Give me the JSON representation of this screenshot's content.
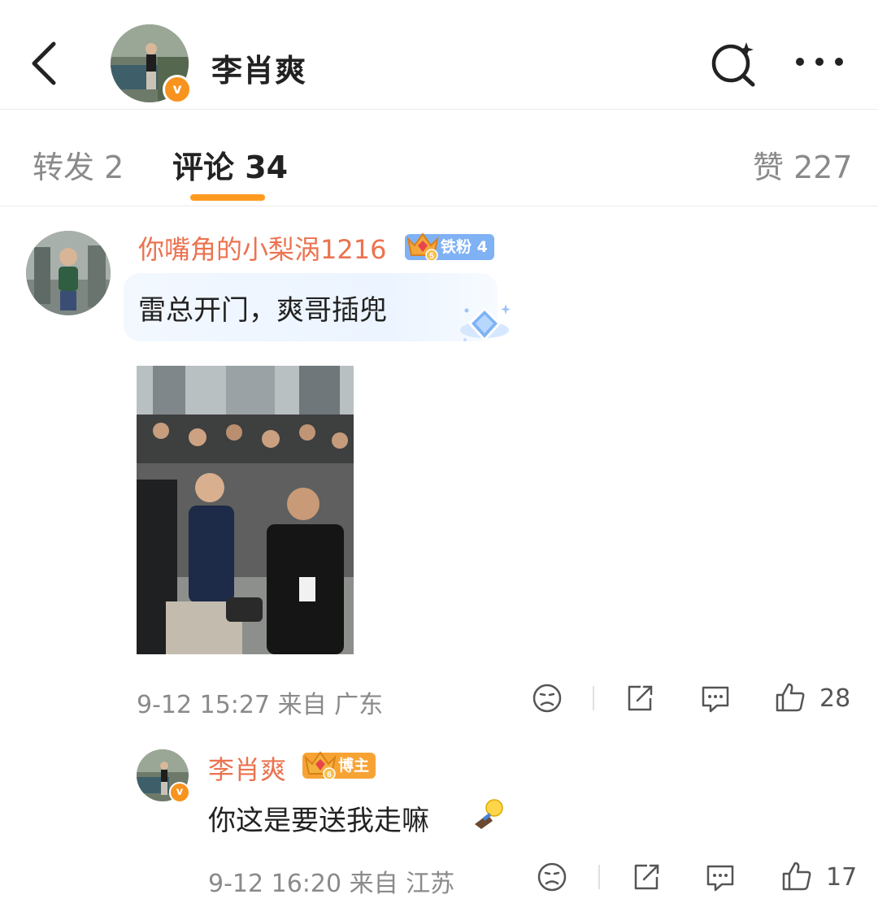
{
  "header": {
    "title": "李肖爽"
  },
  "tabs": {
    "repost": "转发 2",
    "comment": "评论 34",
    "like": "赞 227"
  },
  "comment1": {
    "username": "你嘴角的小梨涡1216",
    "badge_level": "5",
    "badge_label": "铁粉",
    "badge_num": "4",
    "text": "雷总开门，爽哥插兜",
    "time": "9-12 15:27",
    "location": "来自 广东",
    "likes": "28"
  },
  "reply1": {
    "username": "李肖爽",
    "badge_level": "6",
    "badge_label": "博主",
    "text": "你这是要送我走嘛",
    "time": "9-12 16:20",
    "location": "来自 江苏",
    "likes": "17"
  },
  "colors": {
    "accent_orange": "#ff9a1f",
    "username_orange": "#eb7350",
    "fan_badge_blue": "#7fb1f5",
    "blogger_badge_orange": "#f7a334"
  },
  "icons": [
    "back-arrow-icon",
    "search-sparkle-icon",
    "more-dots-icon",
    "dislike-face-icon",
    "share-icon",
    "comment-icon",
    "thumbs-up-icon"
  ]
}
